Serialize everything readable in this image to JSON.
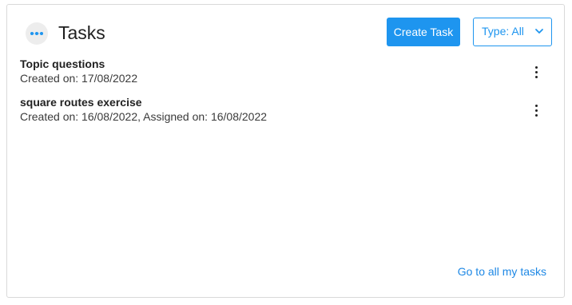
{
  "header": {
    "logo_icon": "timeline-dots-icon",
    "title": "Tasks",
    "create_button_label": "Create Task",
    "type_filter_label": "Type: All",
    "accent_color": "#1e95ef"
  },
  "tasks": [
    {
      "name": "Topic questions",
      "meta": "Created on: 17/08/2022",
      "menu_icon": "more-vertical-icon"
    },
    {
      "name": "square routes exercise",
      "meta": "Created on: 16/08/2022, Assigned on: 16/08/2022",
      "menu_icon": "more-vertical-icon"
    }
  ],
  "footer": {
    "all_tasks_link": "Go to all my tasks"
  }
}
